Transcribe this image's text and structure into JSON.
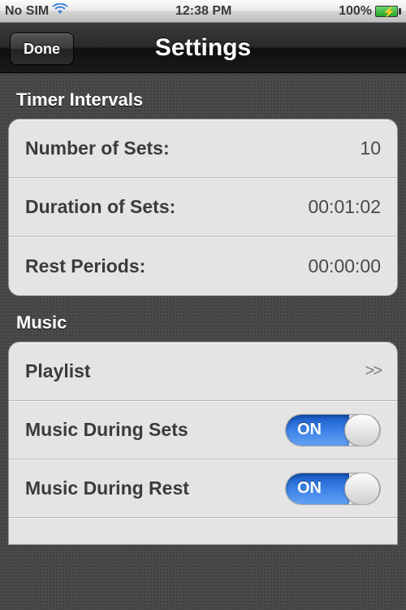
{
  "statusBar": {
    "carrier": "No SIM",
    "time": "12:38 PM",
    "batteryPercent": "100%"
  },
  "nav": {
    "title": "Settings",
    "doneLabel": "Done"
  },
  "sections": {
    "timer": {
      "header": "Timer Intervals",
      "rows": {
        "numberOfSets": {
          "label": "Number of Sets:",
          "value": "10"
        },
        "durationOfSets": {
          "label": "Duration of Sets:",
          "value": "00:01:02"
        },
        "restPeriods": {
          "label": "Rest Periods:",
          "value": "00:00:00"
        }
      }
    },
    "music": {
      "header": "Music",
      "rows": {
        "playlist": {
          "label": "Playlist",
          "chevron": ">>"
        },
        "musicDuringSets": {
          "label": "Music During Sets",
          "toggle": "ON"
        },
        "musicDuringRest": {
          "label": "Music During Rest",
          "toggle": "ON"
        }
      }
    }
  }
}
